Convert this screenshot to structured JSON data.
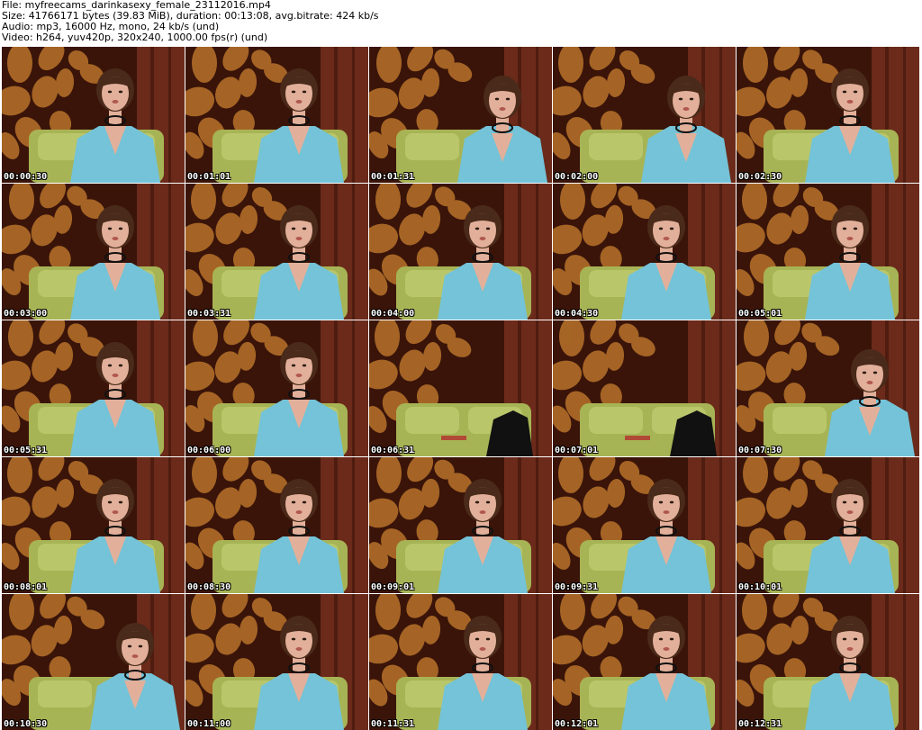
{
  "header": {
    "file_line": "File: myfreecams_darinkasexy_female_23112016.mp4",
    "size_line": "Size: 41766171 bytes (39.83 MiB), duration: 00:13:08, avg.bitrate: 424 kb/s",
    "audio_line": "Audio: mp3, 16000 Hz, mono, 24 kb/s (und)",
    "video_line": "Video: h264, yuv420p, 320x240, 1000.00 fps(r) (und)"
  },
  "colors": {
    "wall_dark": "#3a1409",
    "wall_pattern": "#b8732a",
    "curtain": "#6b2a1a",
    "sofa": "#a7b455",
    "shirt": "#74c3d8",
    "skin": "#e2b09a",
    "hair": "#4a2a1a",
    "timestamp": "#ffffff"
  },
  "thumbnails": [
    {
      "timestamp": "00:00:30",
      "scene": "person"
    },
    {
      "timestamp": "00:01:01",
      "scene": "person"
    },
    {
      "timestamp": "00:01:31",
      "scene": "person-leaning"
    },
    {
      "timestamp": "00:02:00",
      "scene": "person-leaning"
    },
    {
      "timestamp": "00:02:30",
      "scene": "person"
    },
    {
      "timestamp": "00:03:00",
      "scene": "person"
    },
    {
      "timestamp": "00:03:31",
      "scene": "person"
    },
    {
      "timestamp": "00:04:00",
      "scene": "person"
    },
    {
      "timestamp": "00:04:30",
      "scene": "person"
    },
    {
      "timestamp": "00:05:01",
      "scene": "person"
    },
    {
      "timestamp": "00:05:31",
      "scene": "person"
    },
    {
      "timestamp": "00:06:00",
      "scene": "person"
    },
    {
      "timestamp": "00:06:31",
      "scene": "empty"
    },
    {
      "timestamp": "00:07:01",
      "scene": "empty"
    },
    {
      "timestamp": "00:07:30",
      "scene": "person-leaning"
    },
    {
      "timestamp": "00:08:01",
      "scene": "person"
    },
    {
      "timestamp": "00:08:30",
      "scene": "person"
    },
    {
      "timestamp": "00:09:01",
      "scene": "person"
    },
    {
      "timestamp": "00:09:31",
      "scene": "person"
    },
    {
      "timestamp": "00:10:01",
      "scene": "person"
    },
    {
      "timestamp": "00:10:30",
      "scene": "person-leaning"
    },
    {
      "timestamp": "00:11:00",
      "scene": "person"
    },
    {
      "timestamp": "00:11:31",
      "scene": "person"
    },
    {
      "timestamp": "00:12:01",
      "scene": "person"
    },
    {
      "timestamp": "00:12:31",
      "scene": "person"
    }
  ]
}
